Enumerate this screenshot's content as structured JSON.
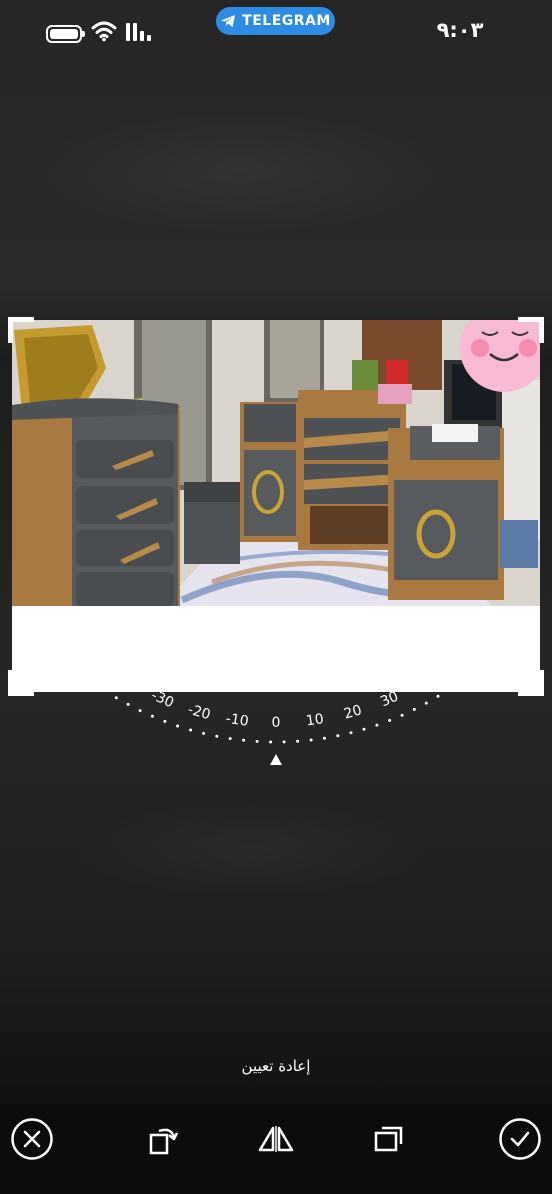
{
  "status_bar": {
    "app_pill": "TELEGRAM",
    "time": "٩:٠٣",
    "icons": [
      "battery-icon",
      "wifi-icon",
      "signal-icon",
      "telegram-icon"
    ]
  },
  "crop_editor": {
    "rotation_dial": {
      "ticks": [
        "-30",
        "-20",
        "-10",
        "0",
        "10",
        "20",
        "30"
      ],
      "current_angle": 0
    },
    "reset_label": "إعادة تعيين"
  },
  "toolbar": {
    "buttons": [
      {
        "name": "cancel",
        "icon": "close-icon"
      },
      {
        "name": "rotate",
        "icon": "rotate-icon"
      },
      {
        "name": "flip",
        "icon": "flip-icon"
      },
      {
        "name": "aspect-ratio",
        "icon": "aspect-ratio-icon"
      },
      {
        "name": "done",
        "icon": "checkmark-icon"
      }
    ]
  },
  "colors": {
    "telegram_accent": "#2c8ce3",
    "background": "#222222",
    "toolbar": "#0c0c0c"
  }
}
